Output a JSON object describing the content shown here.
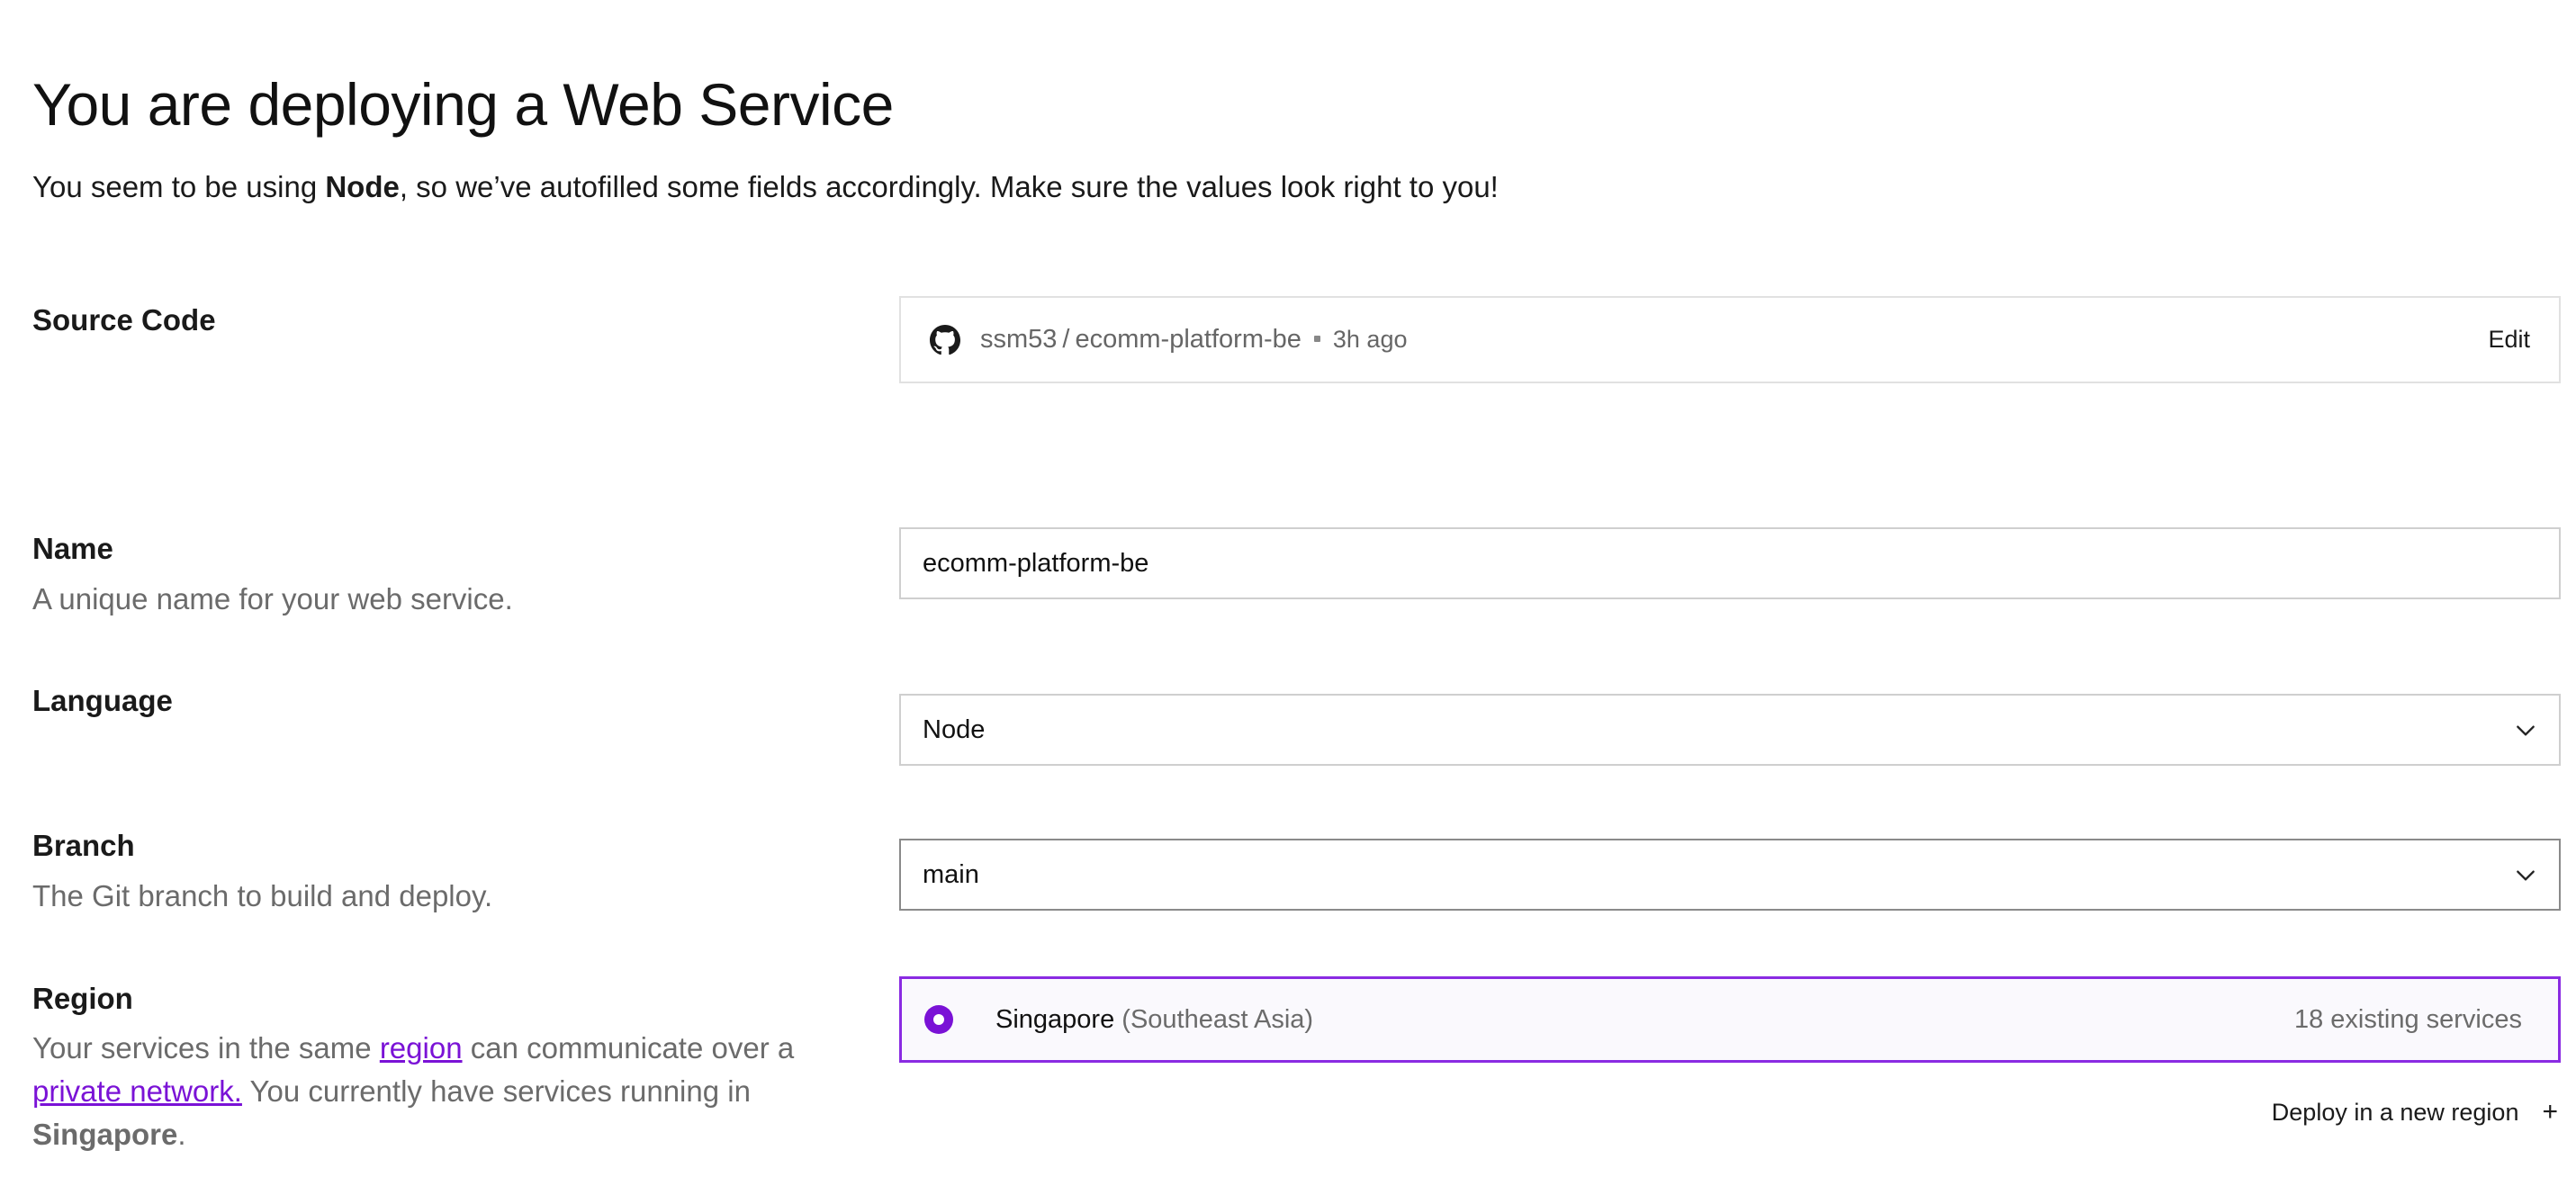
{
  "page": {
    "title": "You are deploying a Web Service",
    "subtitle_pre": "You seem to be using ",
    "subtitle_bold": "Node",
    "subtitle_post": ", so we’ve autofilled some fields accordingly. Make sure the values look right to you!"
  },
  "source_code": {
    "label": "Source Code",
    "owner": "ssm53",
    "separator": "/",
    "repo": "ecomm-platform-be",
    "time": "3h ago",
    "edit_label": "Edit",
    "icon": "github-icon"
  },
  "name": {
    "label": "Name",
    "description": "A unique name for your web service.",
    "value": "ecomm-platform-be"
  },
  "language": {
    "label": "Language",
    "value": "Node",
    "icon": "chevron-down-icon"
  },
  "branch": {
    "label": "Branch",
    "description": "The Git branch to build and deploy.",
    "value": "main",
    "icon": "chevron-down-icon"
  },
  "region": {
    "label": "Region",
    "desc_part1": "Your services in the same ",
    "desc_link1": "region",
    "desc_part2": " can communicate over a ",
    "desc_link2": "private network.",
    "desc_part3": " You currently have services running in ",
    "desc_bold": "Singapore",
    "desc_part4": ".",
    "option_name": "Singapore",
    "option_sub": "(Southeast Asia)",
    "option_count": "18 existing services",
    "deploy_new_label": "Deploy in a new region",
    "deploy_new_icon": "+",
    "accent_color": "#7a12d6"
  }
}
